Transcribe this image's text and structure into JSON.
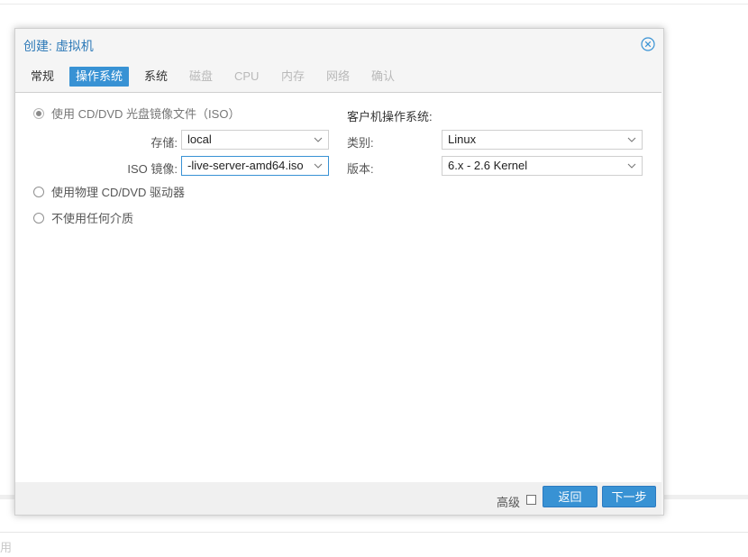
{
  "dialog": {
    "title": "创建: 虚拟机",
    "close_icon": "close-circle-icon",
    "tabs": [
      {
        "label": "常规",
        "state": "normal"
      },
      {
        "label": "操作系统",
        "state": "active"
      },
      {
        "label": "系统",
        "state": "normal"
      },
      {
        "label": "磁盘",
        "state": "disabled"
      },
      {
        "label": "CPU",
        "state": "disabled"
      },
      {
        "label": "内存",
        "state": "disabled"
      },
      {
        "label": "网络",
        "state": "disabled"
      },
      {
        "label": "确认",
        "state": "disabled"
      }
    ]
  },
  "media": {
    "use_iso_label": "使用 CD/DVD 光盘镜像文件（ISO）",
    "use_iso_checked": true,
    "storage_label": "存储:",
    "storage_value": "local",
    "iso_label": "ISO 镜像:",
    "iso_value": "-live-server-amd64.iso",
    "physical_label": "使用物理 CD/DVD 驱动器",
    "none_label": "不使用任何介质"
  },
  "guest_os": {
    "title": "客户机操作系统:",
    "type_label": "类别:",
    "type_value": "Linux",
    "version_label": "版本:",
    "version_value": "6.x - 2.6 Kernel"
  },
  "footer": {
    "advanced_label": "高级",
    "advanced_checked": false,
    "back_label": "返回",
    "next_label": "下一步"
  },
  "background": {
    "fragment_text": "用"
  },
  "colors": {
    "accent": "#3892d4",
    "title": "#2e7ab8",
    "disabled_text": "#b9b9b9"
  }
}
